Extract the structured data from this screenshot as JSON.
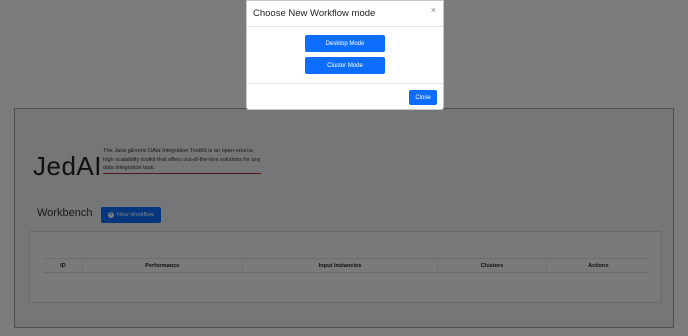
{
  "page": {
    "brand": "JedAI",
    "tagline": "The Java gEneric DAta Integration ToolKit is an open-source, high scalability toolkit that offers out-of-the-box solutions for any data integration task.",
    "workbench_label": "Workbench",
    "new_workflow_label": "New Workflow",
    "table": {
      "columns": [
        "ID",
        "Performance",
        "Input Instancies",
        "Clusters",
        "Actions"
      ]
    }
  },
  "modal": {
    "title": "Choose New Workflow mode",
    "close_glyph": "×",
    "desktop_mode_label": "Desktop Mode",
    "cluster_mode_label": "Cluster Mode",
    "close_label": "Close"
  },
  "colors": {
    "primary": "#0d6efd",
    "underline": "#b02a2a"
  },
  "icons": {
    "new_workflow": "plus-circle-icon",
    "modal_close": "close-icon"
  }
}
